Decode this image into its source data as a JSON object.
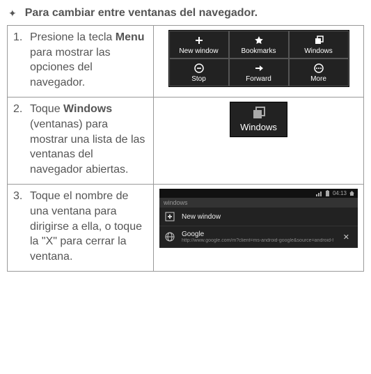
{
  "header": {
    "title": "Para cambiar entre ventanas del navegador."
  },
  "steps": [
    {
      "num": "1.",
      "before": "Presione la tecla ",
      "bold": "Menu",
      "after": " para mostrar las opciones del navegador."
    },
    {
      "num": "2.",
      "before": "Toque ",
      "bold": "Windows",
      "after": " (ventanas) para mostrar una lista de las ventanas del navegador abiertas."
    },
    {
      "num": "3.",
      "before": "Toque el nombre de una ventana para dirigirse a ella, o toque la \"X\" para cerrar la ventana.",
      "bold": "",
      "after": ""
    }
  ],
  "ill1": {
    "cells": [
      [
        "New window",
        "Bookmarks",
        "Windows"
      ],
      [
        "Stop",
        "Forward",
        "More"
      ]
    ]
  },
  "ill2": {
    "label": "Windows"
  },
  "ill3": {
    "time": "04:13",
    "section": "windows",
    "rows": [
      {
        "title": "New window",
        "sub": ""
      },
      {
        "title": "Google",
        "sub": "http://www.google.com/m?client=ms-android-google&source=android-home"
      }
    ]
  }
}
